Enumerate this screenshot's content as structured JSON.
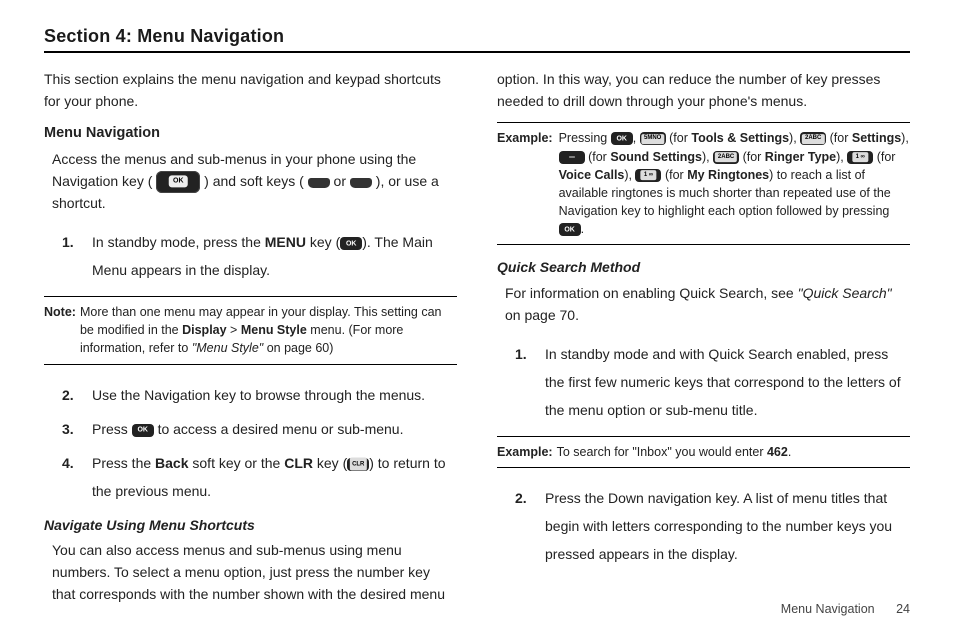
{
  "section_title": "Section 4: Menu Navigation",
  "left": {
    "intro": "This section explains the menu navigation and keypad shortcuts for your phone.",
    "h2": "Menu Navigation",
    "p1a": "Access the menus and sub-menus in your phone using the Navigation key (",
    "p1b": ") and soft keys (",
    "p1c": " or ",
    "p1d": "), or use a shortcut.",
    "step1_num": "1.",
    "step1a": "In standby mode, press the ",
    "step1_menu": "MENU",
    "step1b": " key (",
    "step1c": "). The Main Menu appears in the display.",
    "note_label": "Note:",
    "note_a": "More than one menu may appear in your display. This setting can be modified in the ",
    "note_display": "Display",
    "note_gt": " > ",
    "note_menustyle": "Menu Style",
    "note_b": " menu. (For more information, refer to ",
    "note_ref": "\"Menu Style\"",
    "note_c": " on page 60)",
    "step2_num": "2.",
    "step2": "Use the Navigation key to browse through the menus.",
    "step3_num": "3.",
    "step3a": "Press ",
    "step3b": " to access a desired menu or sub-menu.",
    "step4_num": "4.",
    "step4a": "Press the ",
    "step4_back": "Back",
    "step4b": " soft key or the ",
    "step4_clr": "CLR",
    "step4c": " key (",
    "step4d": ") to return to the previous menu.",
    "h3": "Navigate Using Menu Shortcuts",
    "p2": "You can also access menus and sub-menus using menu numbers. To select a menu option, just press the number key that corresponds with the number shown with the desired menu"
  },
  "right": {
    "p0": "option. In this way, you can reduce the number of key presses needed to drill down through your phone's menus.",
    "ex1_label": "Example:",
    "ex1_a": "Pressing ",
    "ex1_b": ", ",
    "ex1_c": " (for ",
    "tools": "Tools & Settings",
    "ex1_d": "), ",
    "settings": "Settings",
    "sound": "Sound Settings",
    "ringer": "Ringer Type",
    "voice": "Voice Calls",
    "myring": "My Ringtones",
    "ex1_tail": ") to reach a list of available ringtones is much shorter than repeated use of the Navigation key to highlight each option followed by pressing ",
    "period": ".",
    "h3": "Quick Search Method",
    "p1a": "For information on enabling Quick Search, see ",
    "p1_ref": "\"Quick Search\"",
    "p1b": " on page 70.",
    "step1_num": "1.",
    "step1": "In standby mode and with Quick Search enabled, press the first few numeric keys that correspond to the letters of the menu option or sub-menu title.",
    "ex2_label": "Example:",
    "ex2_a": "To search for \"Inbox\" you would enter ",
    "ex2_num": "462",
    "step2_num": "2.",
    "step2": "Press the Down navigation key. A list of menu titles that begin with letters corresponding to the number keys you pressed appears in the display."
  },
  "footer": {
    "label": "Menu Navigation",
    "page": "24"
  }
}
